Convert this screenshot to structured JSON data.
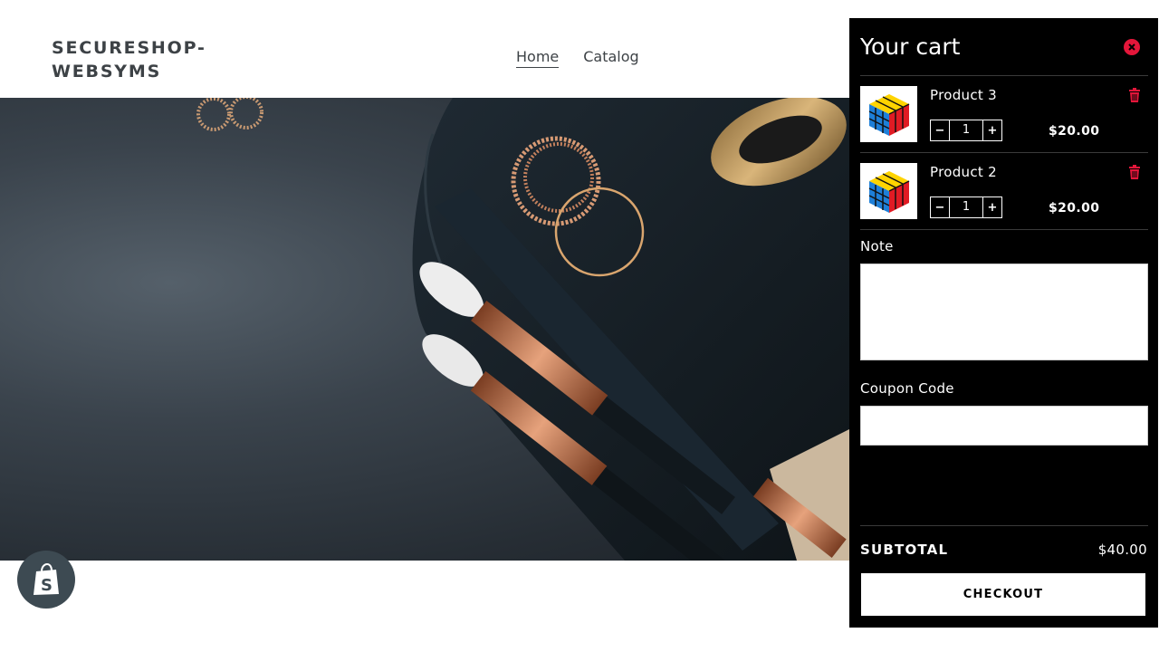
{
  "header": {
    "logo": "SECURESHOP-WEBSYMS",
    "nav": [
      {
        "label": "Home",
        "active": true
      },
      {
        "label": "Catalog",
        "active": false
      }
    ]
  },
  "hero": {
    "image_icon": "hero-photo-makeup-brushes-rings"
  },
  "cart": {
    "title": "Your cart",
    "close_icon": "close-icon",
    "items": [
      {
        "name": "Product 3",
        "quantity": "1",
        "price": "$20.00",
        "thumb_icon": "rubiks-cube-icon"
      },
      {
        "name": "Product 2",
        "quantity": "1",
        "price": "$20.00",
        "thumb_icon": "rubiks-cube-icon"
      }
    ],
    "qty_minus": "−",
    "qty_plus": "+",
    "note_label": "Note",
    "note_value": "",
    "coupon_label": "Coupon Code",
    "coupon_value": "",
    "subtotal_label": "SUBTOTAL",
    "subtotal_value": "$40.00",
    "checkout_label": "CHECKOUT"
  },
  "colors": {
    "drawer_bg": "#000000",
    "accent_red": "#e4163a",
    "text_dark": "#3d4246"
  }
}
